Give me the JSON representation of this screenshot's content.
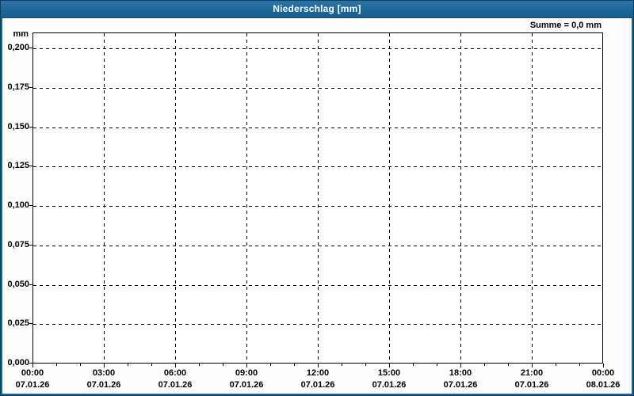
{
  "titlebar": {
    "title": "Niederschlag [mm]"
  },
  "summary": {
    "text": "Summe = 0,0 mm"
  },
  "axis": {
    "unit_label": "mm",
    "y_tick_labels": [
      "0,200",
      "0,175",
      "0,150",
      "0,125",
      "0,100",
      "0,075",
      "0,050",
      "0,025",
      "0,000"
    ],
    "x_ticks": [
      {
        "time": "00:00",
        "date": "07.01.26"
      },
      {
        "time": "03:00",
        "date": "07.01.26"
      },
      {
        "time": "06:00",
        "date": "07.01.26"
      },
      {
        "time": "09:00",
        "date": "07.01.26"
      },
      {
        "time": "12:00",
        "date": "07.01.26"
      },
      {
        "time": "15:00",
        "date": "07.01.26"
      },
      {
        "time": "18:00",
        "date": "07.01.26"
      },
      {
        "time": "21:00",
        "date": "07.01.26"
      },
      {
        "time": "00:00",
        "date": "08.01.26"
      }
    ]
  },
  "colors": {
    "titlebar_blue": "#1e6899",
    "window_frame_blue": "#1b6495",
    "frame_dark_edge": "#0d3c5f",
    "grid_black": "#000000",
    "title_text": "#ffffff",
    "label_text": "#000000",
    "background": "#fdfdfd"
  },
  "chart_data": {
    "type": "line",
    "title": "Niederschlag [mm]",
    "ylabel": "mm",
    "ylim": [
      0.0,
      0.21
    ],
    "yticks": [
      0.2,
      0.175,
      0.15,
      0.125,
      0.1,
      0.075,
      0.05,
      0.025,
      0.0
    ],
    "x_tick_times": [
      "00:00",
      "03:00",
      "06:00",
      "09:00",
      "12:00",
      "15:00",
      "18:00",
      "21:00",
      "00:00"
    ],
    "x_tick_dates": [
      "07.01.26",
      "07.01.26",
      "07.01.26",
      "07.01.26",
      "07.01.26",
      "07.01.26",
      "07.01.26",
      "07.01.26",
      "08.01.26"
    ],
    "x_minor_tick_interval_hours": 1,
    "x_major_tick_interval_hours": 3,
    "series": [],
    "sum_mm": 0.0,
    "annotations": [
      "Summe = 0,0 mm"
    ],
    "grid": true,
    "grid_style": "dashed",
    "legend": "none"
  }
}
